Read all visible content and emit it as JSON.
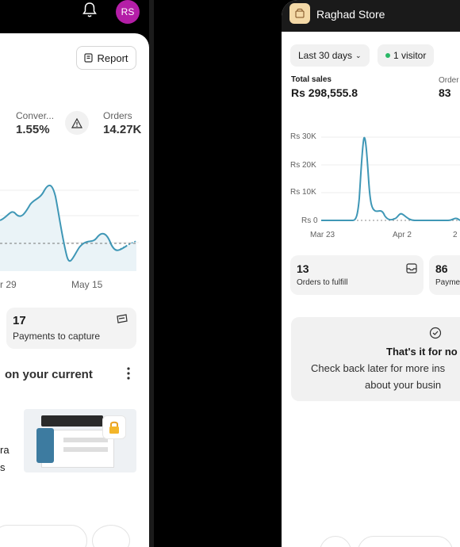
{
  "left": {
    "avatar_initials": "RS",
    "report_label": "Report",
    "conversion_label": "Conver...",
    "conversion_value": "1.55%",
    "orders_label": "Orders",
    "orders_value": "14.27K",
    "x_tick_left": "r 29",
    "x_tick_right": "May 15",
    "payments_count": "17",
    "payments_label": "Payments to capture",
    "section_title": "on your current",
    "promo_line1": "ra",
    "promo_line2": "s"
  },
  "right": {
    "store_name": "Raghad Store",
    "date_range": "Last 30 days",
    "visitors": "1 visitor",
    "total_sales_label": "Total sales",
    "total_sales_value": "Rs 298,555.8",
    "orders_label": "Order",
    "orders_value": "83",
    "y_ticks": [
      "Rs 30K",
      "Rs 20K",
      "Rs 10K",
      "Rs 0"
    ],
    "x_ticks": [
      "Mar 23",
      "Apr 2",
      "2"
    ],
    "fulfill_count": "13",
    "fulfill_label": "Orders to fulfill",
    "payments_count": "86",
    "payments_label": "Payme",
    "empty_title": "That's it for no",
    "empty_line1": "Check back later for more ins",
    "empty_line2": "about your busin"
  },
  "colors": {
    "line": "#3f97b6",
    "avatar": "#b41ea7",
    "live_dot": "#29b866"
  }
}
